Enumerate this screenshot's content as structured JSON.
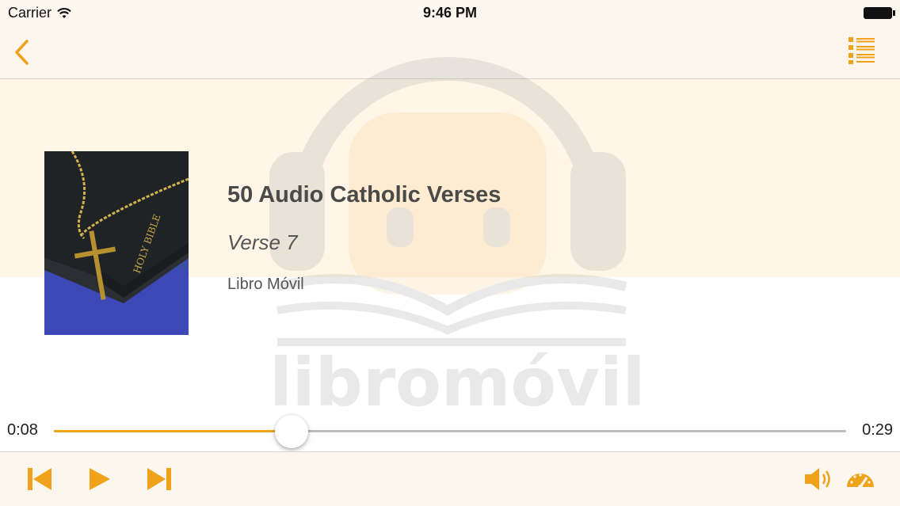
{
  "status_bar": {
    "carrier": "Carrier",
    "time": "9:46 PM"
  },
  "nav": {
    "back_icon": "chevron-left-icon",
    "list_icon": "list-icon"
  },
  "watermark": {
    "logo_text": "libromóvil"
  },
  "track": {
    "title": "50 Audio Catholic Verses",
    "chapter": "Verse 7",
    "author": "Libro Móvil",
    "cover_description": "bible-with-rosary-cover"
  },
  "player": {
    "elapsed": "0:08",
    "total": "0:29",
    "progress_fraction": 0.3
  },
  "toolbar": {
    "icons": [
      "skip-back-icon",
      "play-icon",
      "skip-forward-icon",
      "volume-icon",
      "speed-icon"
    ]
  },
  "colors": {
    "accent": "#f0a21b",
    "bar_bg": "#fdf6ee",
    "band_bg": "#fff6e8",
    "track": "#bdbdbd"
  }
}
